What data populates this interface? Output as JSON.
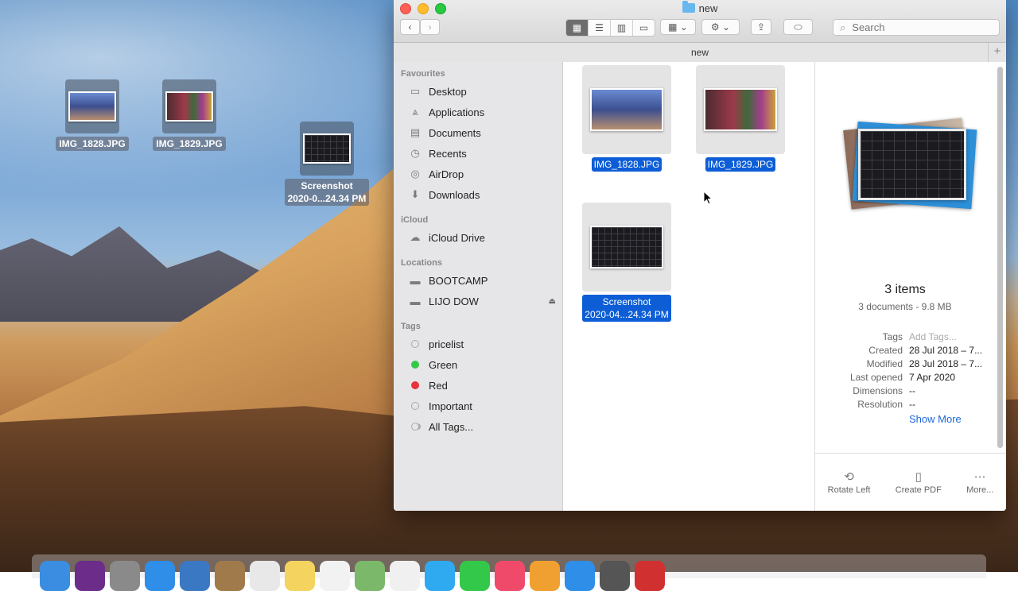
{
  "desktop": {
    "icons": [
      {
        "name": "IMG_1828.JPG"
      },
      {
        "name": "IMG_1829.JPG"
      },
      {
        "name_line1": "Screenshot",
        "name_line2": "2020-0...24.34 PM"
      }
    ]
  },
  "window": {
    "title": "new",
    "path_title": "new",
    "search_placeholder": "Search",
    "toolbar": {
      "back": "‹",
      "forward": "›",
      "views": [
        "icon-view",
        "list-view",
        "column-view",
        "gallery-view"
      ],
      "active_view": "icon-view"
    }
  },
  "sidebar": {
    "favourites_title": "Favourites",
    "favourites": [
      "Desktop",
      "Applications",
      "Documents",
      "Recents",
      "AirDrop",
      "Downloads"
    ],
    "icloud_title": "iCloud",
    "icloud": [
      "iCloud Drive"
    ],
    "locations_title": "Locations",
    "locations": [
      "BOOTCAMP",
      "LIJO DOW"
    ],
    "tags_title": "Tags",
    "tags": [
      {
        "label": "pricelist",
        "color": "#b8b8b8"
      },
      {
        "label": "Green",
        "color": "#34c84a"
      },
      {
        "label": "Red",
        "color": "#e8323c"
      },
      {
        "label": "Important",
        "color": "#b8b8b8"
      },
      {
        "label": "All Tags...",
        "color": "#b8b8b8"
      }
    ]
  },
  "files": [
    {
      "name": "IMG_1828.JPG"
    },
    {
      "name": "IMG_1829.JPG"
    },
    {
      "name_line1": "Screenshot",
      "name_line2": "2020-04...24.34 PM"
    }
  ],
  "preview": {
    "count": "3 items",
    "subtitle": "3 documents - 9.8 MB",
    "meta": [
      {
        "key": "Tags",
        "value": "Add Tags..."
      },
      {
        "key": "Created",
        "value": "28 Jul 2018 – 7..."
      },
      {
        "key": "Modified",
        "value": "28 Jul 2018 – 7..."
      },
      {
        "key": "Last opened",
        "value": "7 Apr 2020"
      },
      {
        "key": "Dimensions",
        "value": "--"
      },
      {
        "key": "Resolution",
        "value": "--"
      }
    ],
    "show_more": "Show More",
    "actions": [
      "Rotate Left",
      "Create PDF",
      "More..."
    ]
  },
  "colors": {
    "selection": "#0d5ed6",
    "link": "#1a66d6"
  }
}
